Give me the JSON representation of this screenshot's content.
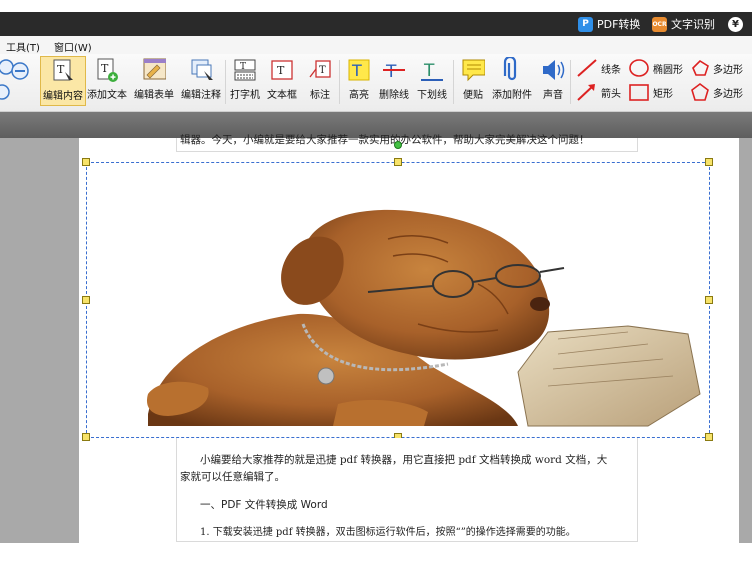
{
  "titlebar": {
    "pdf_convert": "PDF转换",
    "ocr": "文字识别",
    "pdf_icon": "P",
    "ocr_icon": "OCR",
    "yen_icon": "¥"
  },
  "menubar": {
    "tools": "工具(T)",
    "window": "窗口(W)"
  },
  "toolbar": {
    "edit_content": "编辑内容",
    "add_text": "添加文本",
    "edit_form": "编辑表单",
    "edit_comment": "编辑注释",
    "typewriter": "打字机",
    "textbox": "文本框",
    "callout": "标注",
    "highlight": "高亮",
    "strikethrough": "删除线",
    "underline": "下划线",
    "sticky_note": "便贴",
    "attach_file": "添加附件",
    "sound": "声音",
    "line": "线条",
    "ellipse": "椭圆形",
    "polygon": "多边形",
    "arrow": "箭头",
    "rectangle": "矩形",
    "polygon2": "多边形"
  },
  "doc": {
    "top_line": "辑器。今天，小编就是要给大家推荐一款实用的办公软件，帮助大家完美解决这个问题！",
    "para1_line1": "小编要给大家推荐的就是迅捷 pdf 转换器，用它直接把 pdf 文档转换成 word 文档，大",
    "para1_line2": "家就可以任意编辑了。",
    "heading": "一、PDF 文件转换成 Word",
    "step1": "1. 下载安装迅捷 pdf 转换器，双击图标运行软件后，按照“”的操作选择需要的功能。"
  },
  "colors": {
    "accent_blue": "#3a6fd0",
    "active_tool": "#fbe7a6",
    "title_bar": "#2a2a2a"
  }
}
